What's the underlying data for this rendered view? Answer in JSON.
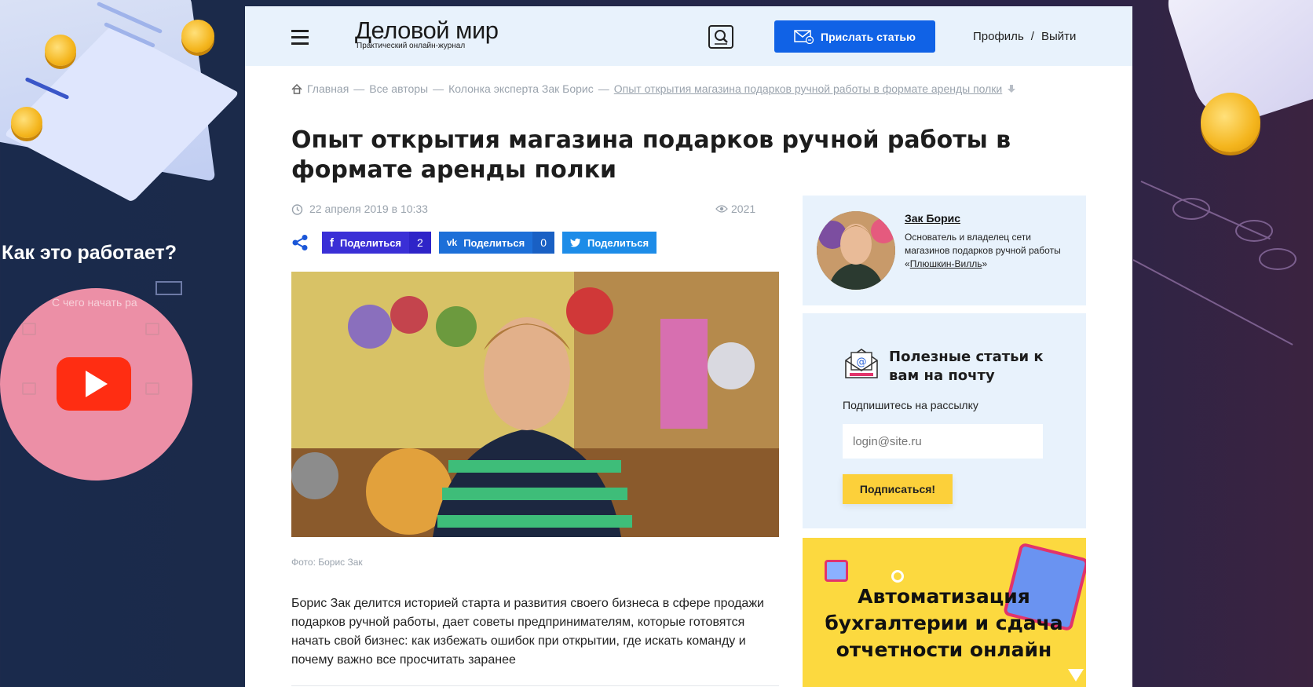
{
  "promo_left": {
    "title": "Как это работает?",
    "hint": "С чего начать ра"
  },
  "header": {
    "logo_main": "Деловой мир",
    "logo_sub": "Практический онлайн-журнал",
    "send_label": "Прислать статью",
    "profile_label": "Профиль",
    "separator": "/",
    "logout_label": "Выйти"
  },
  "breadcrumb": {
    "home": "Главная",
    "sep": "—",
    "authors": "Все авторы",
    "column": "Колонка эксперта Зак Борис",
    "current": "Опыт открытия магазина подарков ручной работы в формате аренды полки"
  },
  "article": {
    "title": "Опыт открытия магазина подарков ручной работы в формате аренды полки",
    "date": "22 апреля 2019 в 10:33",
    "views": "2021",
    "photo_caption": "Фото: Борис Зак",
    "lead": "Борис Зак делится историей старта и развития своего бизнеса в сфере продажи подарков ручной работы, дает советы предпринимателям, которые готовятся начать свой бизнес: как избежать ошибок при открытии, где искать команду и почему важно все просчитать заранее"
  },
  "share": {
    "fb_label": "Поделиться",
    "fb_count": "2",
    "vk_label": "Поделиться",
    "vk_count": "0",
    "tw_label": "Поделиться"
  },
  "author": {
    "name": "Зак Борис",
    "desc_before": "Основатель и владелец сети магазинов подарков ручной работы «",
    "desc_link": "Плюшкин-Вилль",
    "desc_after": "»"
  },
  "subscribe": {
    "title": "Полезные статьи к вам на почту",
    "label": "Подпишитесь на рассылку",
    "placeholder": "login@site.ru",
    "button": "Подписаться!"
  },
  "promo_right": {
    "text": "Автоматизация бухгалтерии и сдача отчетности онлайн"
  },
  "colors": {
    "accent_blue": "#1062e6",
    "header_bg": "#e8f2fc",
    "subscribe_button": "#fcd03a",
    "promo_bg": "#fcd93f"
  }
}
